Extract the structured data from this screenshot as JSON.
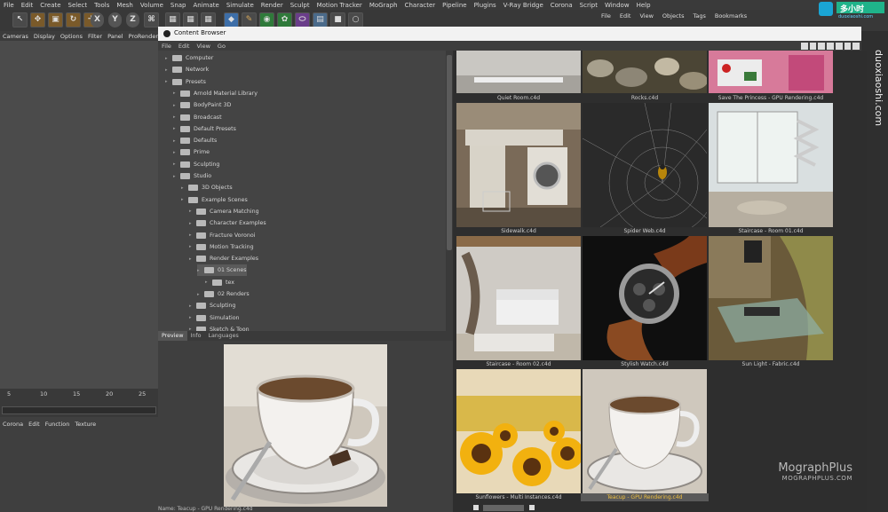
{
  "main_menu": [
    "File",
    "Edit",
    "Create",
    "Select",
    "Tools",
    "Mesh",
    "Volume",
    "Snap",
    "Animate",
    "Simulate",
    "Render",
    "Sculpt",
    "Motion Tracker",
    "MoGraph",
    "Character",
    "Pipeline",
    "Plugins",
    "V-Ray Bridge",
    "Corona",
    "Script",
    "Window",
    "Help"
  ],
  "viewport_menu": [
    "Cameras",
    "Display",
    "Options",
    "Filter",
    "Panel",
    "ProRender"
  ],
  "timeline_ticks": [
    "5",
    "10",
    "15",
    "20",
    "25"
  ],
  "attr_menu": [
    "Corona",
    "Edit",
    "Function",
    "Texture"
  ],
  "right_menu": [
    "File",
    "Edit",
    "View",
    "Objects",
    "Tags",
    "Bookmarks"
  ],
  "content_browser": {
    "title": "Content Browser",
    "menu": [
      "File",
      "Edit",
      "View",
      "Go"
    ],
    "tree": [
      {
        "label": "Computer",
        "level": 0
      },
      {
        "label": "Network",
        "level": 0
      },
      {
        "label": "Presets",
        "level": 0
      },
      {
        "label": "Arnold Material Library",
        "level": 1
      },
      {
        "label": "BodyPaint 3D",
        "level": 1
      },
      {
        "label": "Broadcast",
        "level": 1
      },
      {
        "label": "Default Presets",
        "level": 1
      },
      {
        "label": "Defaults",
        "level": 1
      },
      {
        "label": "Prime",
        "level": 1
      },
      {
        "label": "Sculpting",
        "level": 1
      },
      {
        "label": "Studio",
        "level": 1
      },
      {
        "label": "3D Objects",
        "level": 2
      },
      {
        "label": "Example Scenes",
        "level": 2
      },
      {
        "label": "Camera Matching",
        "level": 3
      },
      {
        "label": "Character Examples",
        "level": 3
      },
      {
        "label": "Fracture Voronoi",
        "level": 3
      },
      {
        "label": "Motion Tracking",
        "level": 3
      },
      {
        "label": "Render Examples",
        "level": 3
      },
      {
        "label": "01 Scenes",
        "level": 4
      },
      {
        "label": "tex",
        "level": 5
      },
      {
        "label": "02 Renders",
        "level": 4
      },
      {
        "label": "Sculpting",
        "level": 3
      },
      {
        "label": "Simulation",
        "level": 3
      },
      {
        "label": "Sketch & Toon",
        "level": 3
      }
    ],
    "tabs": [
      "Preview",
      "Info",
      "Languages"
    ],
    "status_name": "Name: Teacup - GPU Rendering.c4d",
    "tiles": [
      {
        "name": "Quiet Room.c4d"
      },
      {
        "name": "Rocks.c4d"
      },
      {
        "name": "Save The Princess - GPU Rendering.c4d"
      },
      {
        "name": "Sidewalk.c4d"
      },
      {
        "name": "Spider Web.c4d"
      },
      {
        "name": "Staircase - Room 01.c4d"
      },
      {
        "name": "Staircase - Room 02.c4d"
      },
      {
        "name": "Stylish Watch.c4d"
      },
      {
        "name": "Sun Light - Fabric.c4d"
      },
      {
        "name": "Sunflowers - Multi Instances.c4d"
      },
      {
        "name": "Teacup - GPU Rendering.c4d",
        "selected": true
      }
    ]
  },
  "watermark": {
    "side_text": "duoxiaoshi.com",
    "logo_text": "多小时",
    "logo_sub": "duoxiaoshi.com",
    "brand_top": "MographPlus",
    "brand_bottom": "MOGRAPHPLUS.COM"
  }
}
